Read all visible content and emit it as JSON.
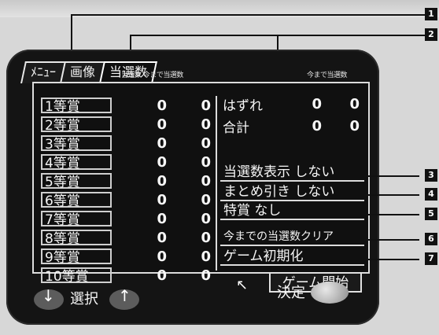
{
  "tabs": [
    {
      "label": "ﾒﾆｭｰ"
    },
    {
      "label": "画像"
    },
    {
      "label": "当選数"
    }
  ],
  "headers": {
    "left": "当選数 今まで当選数",
    "right": "今まで当選数"
  },
  "prizes": [
    {
      "label": "1等賞",
      "a": "0",
      "b": "0"
    },
    {
      "label": "2等賞",
      "a": "0",
      "b": "0"
    },
    {
      "label": "3等賞",
      "a": "0",
      "b": "0"
    },
    {
      "label": "4等賞",
      "a": "0",
      "b": "0"
    },
    {
      "label": "5等賞",
      "a": "0",
      "b": "0"
    },
    {
      "label": "6等賞",
      "a": "0",
      "b": "0"
    },
    {
      "label": "7等賞",
      "a": "0",
      "b": "0"
    },
    {
      "label": "8等賞",
      "a": "0",
      "b": "0"
    },
    {
      "label": "9等賞",
      "a": "0",
      "b": "0"
    },
    {
      "label": "10等賞",
      "a": "0",
      "b": "0"
    }
  ],
  "stats": [
    {
      "label": "はずれ",
      "a": "0",
      "b": "0"
    },
    {
      "label": "合計",
      "a": "0",
      "b": "0"
    }
  ],
  "options": [
    {
      "label": "当選数表示 しない",
      "marker": "3"
    },
    {
      "label": "まとめ引き しない",
      "marker": "4"
    },
    {
      "label": "特賞 なし",
      "marker": "5"
    },
    {
      "label": "今までの当選数クリア",
      "marker": "6"
    },
    {
      "label": "ゲーム初期化",
      "marker": "7"
    }
  ],
  "callouts": [
    {
      "marker": "1"
    },
    {
      "marker": "2"
    }
  ],
  "footer": {
    "select": "選択",
    "confirm": "決定",
    "start": "ゲーム開始",
    "down_arrow": "↓",
    "up_arrow": "↑",
    "cursor": "↖"
  }
}
